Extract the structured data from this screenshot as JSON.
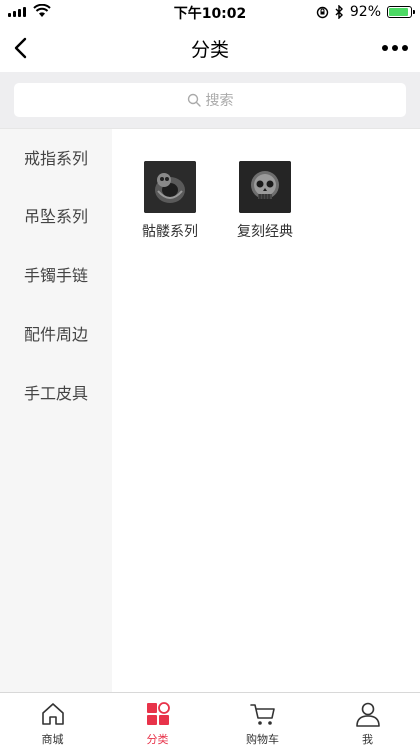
{
  "status_bar": {
    "time": "下午10:02",
    "battery_percent": "92%",
    "battery_level": 0.92
  },
  "nav": {
    "title": "分类"
  },
  "search": {
    "placeholder": "搜索"
  },
  "sidebar": {
    "items": [
      {
        "label": "戒指系列"
      },
      {
        "label": "吊坠系列"
      },
      {
        "label": "手镯手链"
      },
      {
        "label": "配件周边"
      },
      {
        "label": "手工皮具"
      }
    ]
  },
  "categories": [
    {
      "label": "骷髅系列",
      "icon": "skull-ring-image"
    },
    {
      "label": "复刻经典",
      "icon": "skull-ring-image"
    }
  ],
  "tab_bar": {
    "tabs": [
      {
        "label": "商城",
        "icon": "home-icon"
      },
      {
        "label": "分类",
        "icon": "category-icon"
      },
      {
        "label": "购物车",
        "icon": "cart-icon"
      },
      {
        "label": "我",
        "icon": "user-icon"
      }
    ],
    "active_color": "#e8334a"
  }
}
